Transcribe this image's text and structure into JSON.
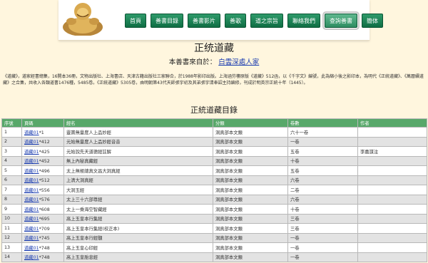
{
  "nav": [
    {
      "label": "首頁"
    },
    {
      "label": "善書目錄"
    },
    {
      "label": "善書影片"
    },
    {
      "label": "善歌"
    },
    {
      "label": "道之宗旨"
    },
    {
      "label": "聯絡我們"
    },
    {
      "label": "查詢善書"
    },
    {
      "label": "簡体"
    }
  ],
  "page": {
    "title": "正统道藏",
    "source_prefix": "本善書來自於：",
    "source_link": "白雲深處人家",
    "description": "《道藏》，道家經書總集，16開本36冊，文物出版社、上海書店、天津古籍出版社三家聯合，於1988年影印出版。上海涵芬樓原版《道藏》512函，以《千字文》編號，此為縮小後之影印本，為明代《正統道藏》、《萬曆續道藏》之合集，共收入各類道書1476種，5485卷。《正統道藏》5305卷，由明朝第43代天師張宇初及其弟張宇清奉詔主持編修，刊成於明英宗正統十年（1445）。",
    "table_title": "正統道藏目錄"
  },
  "table": {
    "headers": [
      "序號",
      "頁碼",
      "經名",
      "分類",
      "卷數",
      "作者"
    ],
    "rows": [
      {
        "no": "1",
        "page": "道藏01",
        "page_suffix": "*1",
        "name": "靈寶無量度人上品妙經",
        "cat": "洞真部本文類",
        "vol": "六十一卷",
        "author": ""
      },
      {
        "no": "2",
        "page": "道藏01",
        "page_suffix": "*412",
        "name": "元始無量度人上品妙經音音",
        "cat": "洞真部本文類",
        "vol": "一卷",
        "author": ""
      },
      {
        "no": "3",
        "page": "道藏01",
        "page_suffix": "*425",
        "name": "元始說先天道德經註解",
        "cat": "洞真部本文類",
        "vol": "五卷",
        "author": "李嘉謀注"
      },
      {
        "no": "4",
        "page": "道藏01",
        "page_suffix": "*452",
        "name": "無上內秘真藏經",
        "cat": "洞真部本文類",
        "vol": "十卷",
        "author": ""
      },
      {
        "no": "5",
        "page": "道藏01",
        "page_suffix": "*496",
        "name": "太上無極總真文昌大洞真經",
        "cat": "洞真部本文類",
        "vol": "五卷",
        "author": ""
      },
      {
        "no": "6",
        "page": "道藏01",
        "page_suffix": "*512",
        "name": "上清大洞真經",
        "cat": "洞真部本文類",
        "vol": "六卷",
        "author": ""
      },
      {
        "no": "7",
        "page": "道藏01",
        "page_suffix": "*556",
        "name": "大洞玉經",
        "cat": "洞真部本文類",
        "vol": "二卷",
        "author": ""
      },
      {
        "no": "8",
        "page": "道藏01",
        "page_suffix": "*576",
        "name": "太上三十六部尊經",
        "cat": "洞真部本文類",
        "vol": "六卷",
        "author": ""
      },
      {
        "no": "9",
        "page": "道藏01",
        "page_suffix": "*608",
        "name": "太上一乘海空智藏經",
        "cat": "洞真部本文類",
        "vol": "十卷",
        "author": ""
      },
      {
        "no": "10",
        "page": "道藏01",
        "page_suffix": "*695",
        "name": "高上玉皇本行集經",
        "cat": "洞真部本文類",
        "vol": "三卷",
        "author": ""
      },
      {
        "no": "11",
        "page": "道藏01",
        "page_suffix": "*709",
        "name": "高上玉皇本行集經(校正本)",
        "cat": "洞真部本文類",
        "vol": "三卷",
        "author": ""
      },
      {
        "no": "12",
        "page": "道藏01",
        "page_suffix": "*745",
        "name": "高上玉皇本行經髓",
        "cat": "洞真部本文類",
        "vol": "一卷",
        "author": ""
      },
      {
        "no": "13",
        "page": "道藏01",
        "page_suffix": "*748",
        "name": "高上玉皇心印經",
        "cat": "洞真部本文類",
        "vol": "一卷",
        "author": ""
      },
      {
        "no": "14",
        "page": "道藏01",
        "page_suffix": "*748",
        "name": "高上玉皇胎息經",
        "cat": "洞真部本文類",
        "vol": "一卷",
        "author": ""
      }
    ]
  }
}
